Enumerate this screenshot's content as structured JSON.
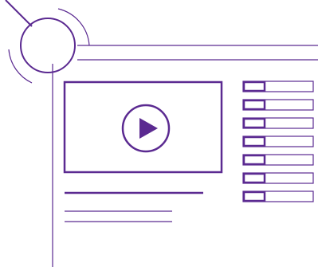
{
  "colors": {
    "accent": "#5b2a91",
    "background": "#ffffff"
  },
  "icons": {
    "play": "play-triangle-icon",
    "magnifier": "circle-magnifier-icon"
  },
  "playlist": {
    "item_count": 7
  },
  "text_placeholder": {
    "line_count": 3
  }
}
